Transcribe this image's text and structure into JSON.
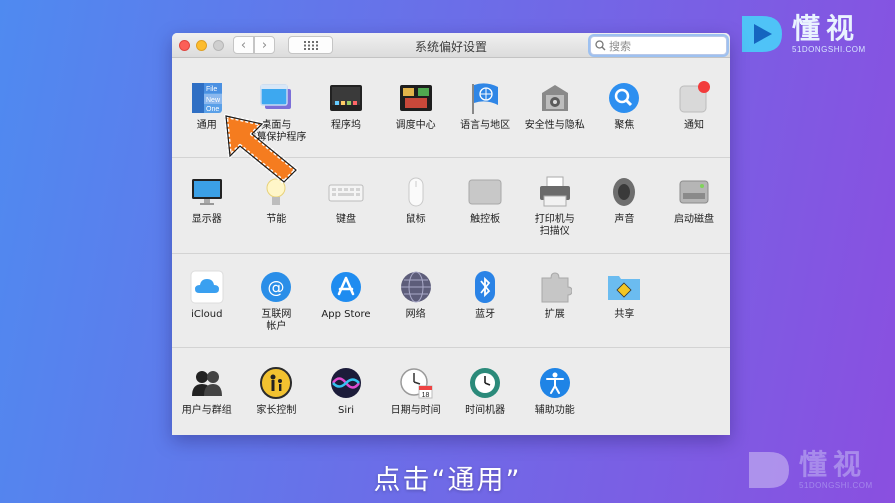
{
  "watermark": {
    "brand_cn": "懂视",
    "brand_en": "51DONGSHI.COM"
  },
  "window": {
    "title": "系统偏好设置",
    "search_placeholder": "搜索"
  },
  "rows": [
    [
      {
        "label": "通用",
        "icon": "general-icon"
      },
      {
        "label": "桌面与\n屏幕保护程序",
        "icon": "desktop-icon"
      },
      {
        "label": "程序坞",
        "icon": "dock-icon"
      },
      {
        "label": "调度中心",
        "icon": "mission-control-icon"
      },
      {
        "label": "语言与地区",
        "icon": "language-region-icon"
      },
      {
        "label": "安全性与隐私",
        "icon": "security-icon"
      },
      {
        "label": "聚焦",
        "icon": "spotlight-icon"
      },
      {
        "label": "通知",
        "icon": "notifications-icon"
      }
    ],
    [
      {
        "label": "显示器",
        "icon": "displays-icon"
      },
      {
        "label": "节能",
        "icon": "energy-saver-icon"
      },
      {
        "label": "键盘",
        "icon": "keyboard-icon"
      },
      {
        "label": "鼠标",
        "icon": "mouse-icon"
      },
      {
        "label": "触控板",
        "icon": "trackpad-icon"
      },
      {
        "label": "打印机与\n扫描仪",
        "icon": "printer-icon"
      },
      {
        "label": "声音",
        "icon": "sound-icon"
      },
      {
        "label": "启动磁盘",
        "icon": "startup-disk-icon"
      }
    ],
    [
      {
        "label": "iCloud",
        "icon": "icloud-icon"
      },
      {
        "label": "互联网\n帐户",
        "icon": "internet-accounts-icon"
      },
      {
        "label": "App Store",
        "icon": "app-store-icon"
      },
      {
        "label": "网络",
        "icon": "network-icon"
      },
      {
        "label": "蓝牙",
        "icon": "bluetooth-icon"
      },
      {
        "label": "扩展",
        "icon": "extensions-icon"
      },
      {
        "label": "共享",
        "icon": "sharing-icon"
      }
    ],
    [
      {
        "label": "用户与群组",
        "icon": "users-groups-icon"
      },
      {
        "label": "家长控制",
        "icon": "parental-controls-icon"
      },
      {
        "label": "Siri",
        "icon": "siri-icon"
      },
      {
        "label": "日期与时间",
        "icon": "date-time-icon"
      },
      {
        "label": "时间机器",
        "icon": "time-machine-icon"
      },
      {
        "label": "辅助功能",
        "icon": "accessibility-icon"
      }
    ]
  ],
  "icon_text": {
    "general_file": "File",
    "general_new": "New",
    "general_one": "One",
    "calendar_day": "18"
  },
  "caption": "点击“通用”",
  "colors": {
    "arrow": "#f57c1f",
    "accent": "#3b82f6"
  }
}
